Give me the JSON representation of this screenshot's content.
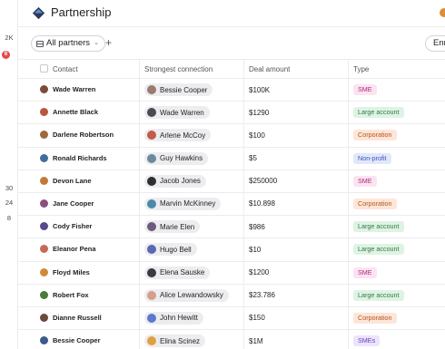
{
  "app": {
    "title": "Partnership"
  },
  "rail": {
    "top_count": "2K",
    "badge": "6",
    "counts": [
      "30",
      "24",
      "8"
    ]
  },
  "toolbar": {
    "filter_label": "All partners",
    "add_label": "+",
    "enrich_label": "Enri"
  },
  "table": {
    "columns": [
      "Contact",
      "Strongest connection",
      "Deal amount",
      "Type"
    ],
    "rows": [
      {
        "contact": "Wade Warren",
        "connection": "Bessie Cooper",
        "deal": "$100K",
        "type": "SME"
      },
      {
        "contact": "Annette Black",
        "connection": "Wade Warren",
        "deal": "$1290",
        "type": "Large account"
      },
      {
        "contact": "Darlene Robertson",
        "connection": "Arlene McCoy",
        "deal": "$100",
        "type": "Corporation"
      },
      {
        "contact": "Ronald Richards",
        "connection": "Guy Hawkins",
        "deal": "$5",
        "type": "Non-profit"
      },
      {
        "contact": "Devon Lane",
        "connection": "Jacob Jones",
        "deal": "$250000",
        "type": "SME"
      },
      {
        "contact": "Jane Cooper",
        "connection": "Marvin McKinney",
        "deal": "$10.898",
        "type": "Corporation"
      },
      {
        "contact": "Cody Fisher",
        "connection": "Marie Elen",
        "deal": "$986",
        "type": "Large account"
      },
      {
        "contact": "Eleanor Pena",
        "connection": "Hugo Bell",
        "deal": "$10",
        "type": "Large account"
      },
      {
        "contact": "Floyd Miles",
        "connection": "Elena Sauske",
        "deal": "$1200",
        "type": "SME"
      },
      {
        "contact": "Robert Fox",
        "connection": "Alice Lewandowsky",
        "deal": "$23.786",
        "type": "Large account"
      },
      {
        "contact": "Dianne Russell",
        "connection": "John Hewitt",
        "deal": "$150",
        "type": "Corporation"
      },
      {
        "contact": "Bessie Cooper",
        "connection": "Elina Scinez",
        "deal": "$1M",
        "type": "SMEs"
      }
    ]
  },
  "type_colors": {
    "SME": {
      "bg": "#fbe4f1",
      "fg": "#b02a7a"
    },
    "SMEs": {
      "bg": "#ece4fb",
      "fg": "#6b3fc0"
    },
    "Large account": {
      "bg": "#dff3e4",
      "fg": "#2f7a45"
    },
    "Corporation": {
      "bg": "#fde6d8",
      "fg": "#b5531c"
    },
    "Non-profit": {
      "bg": "#e2e8fb",
      "fg": "#3b56b3"
    }
  },
  "avatar_colors": [
    "#7a4b3a",
    "#b8563f",
    "#a06a3c",
    "#3f6e9e",
    "#c27a3a",
    "#8a4f7d",
    "#5a4a8a",
    "#c66a54",
    "#d08b3a",
    "#4c7a3c",
    "#6b4a3f",
    "#3c5a8a"
  ],
  "connection_avatar_colors": [
    "#9a7b6e",
    "#4a4a52",
    "#c25b4a",
    "#6b8a9e",
    "#2e2e33",
    "#4a8aa8",
    "#6e5a7a",
    "#5a6ab0",
    "#3a3a40",
    "#d4a08a",
    "#5a7ad0",
    "#e0a040"
  ]
}
